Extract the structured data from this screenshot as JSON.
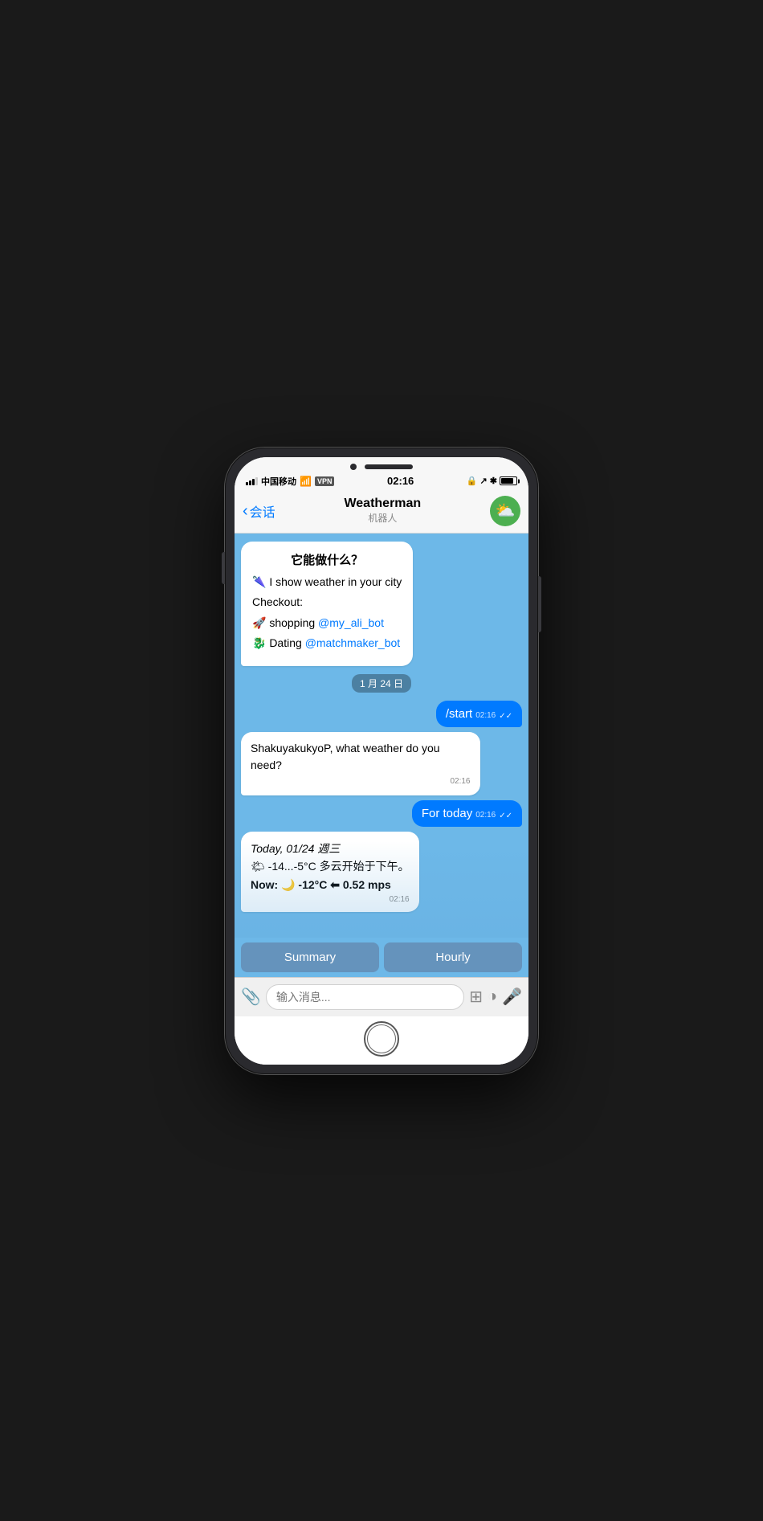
{
  "phone": {
    "status_bar": {
      "carrier": "中国移动",
      "wifi": "WiFi",
      "vpn": "VPN",
      "time": "02:16",
      "battery_level": 85
    },
    "nav": {
      "back_text": "会话",
      "title": "Weatherman",
      "subtitle": "机器人",
      "avatar_emoji": "⛅"
    },
    "chat": {
      "welcome_bubble": {
        "title": "它能做什么？",
        "line1": "🌂 I show weather in your city",
        "checkout_label": "Checkout:",
        "link1_text": "🚀 shopping ",
        "link1_handle": "@my_ali_bot",
        "link2_text": "🐉 Dating ",
        "link2_handle": "@matchmaker_bot"
      },
      "date_divider": "1 月 24 日",
      "user_msg1": {
        "text": "/start",
        "time": "02:16",
        "read": true
      },
      "bot_msg1": {
        "text": "ShakuyakukyoP, what weather do you need?",
        "time": "02:16"
      },
      "user_msg2": {
        "text": "For today",
        "time": "02:16",
        "read": true
      },
      "bot_msg2": {
        "date_line": "Today, 01/24 週三",
        "temp_line": "🌤 -14...-5°C 多云开始于下午。",
        "now_line": "Now: 🌙 -12°C ⬅ 0.52 mps",
        "time": "02:16"
      }
    },
    "action_buttons": {
      "btn1": "Summary",
      "btn2": "Hourly"
    },
    "input_bar": {
      "placeholder": "输入消息..."
    }
  }
}
